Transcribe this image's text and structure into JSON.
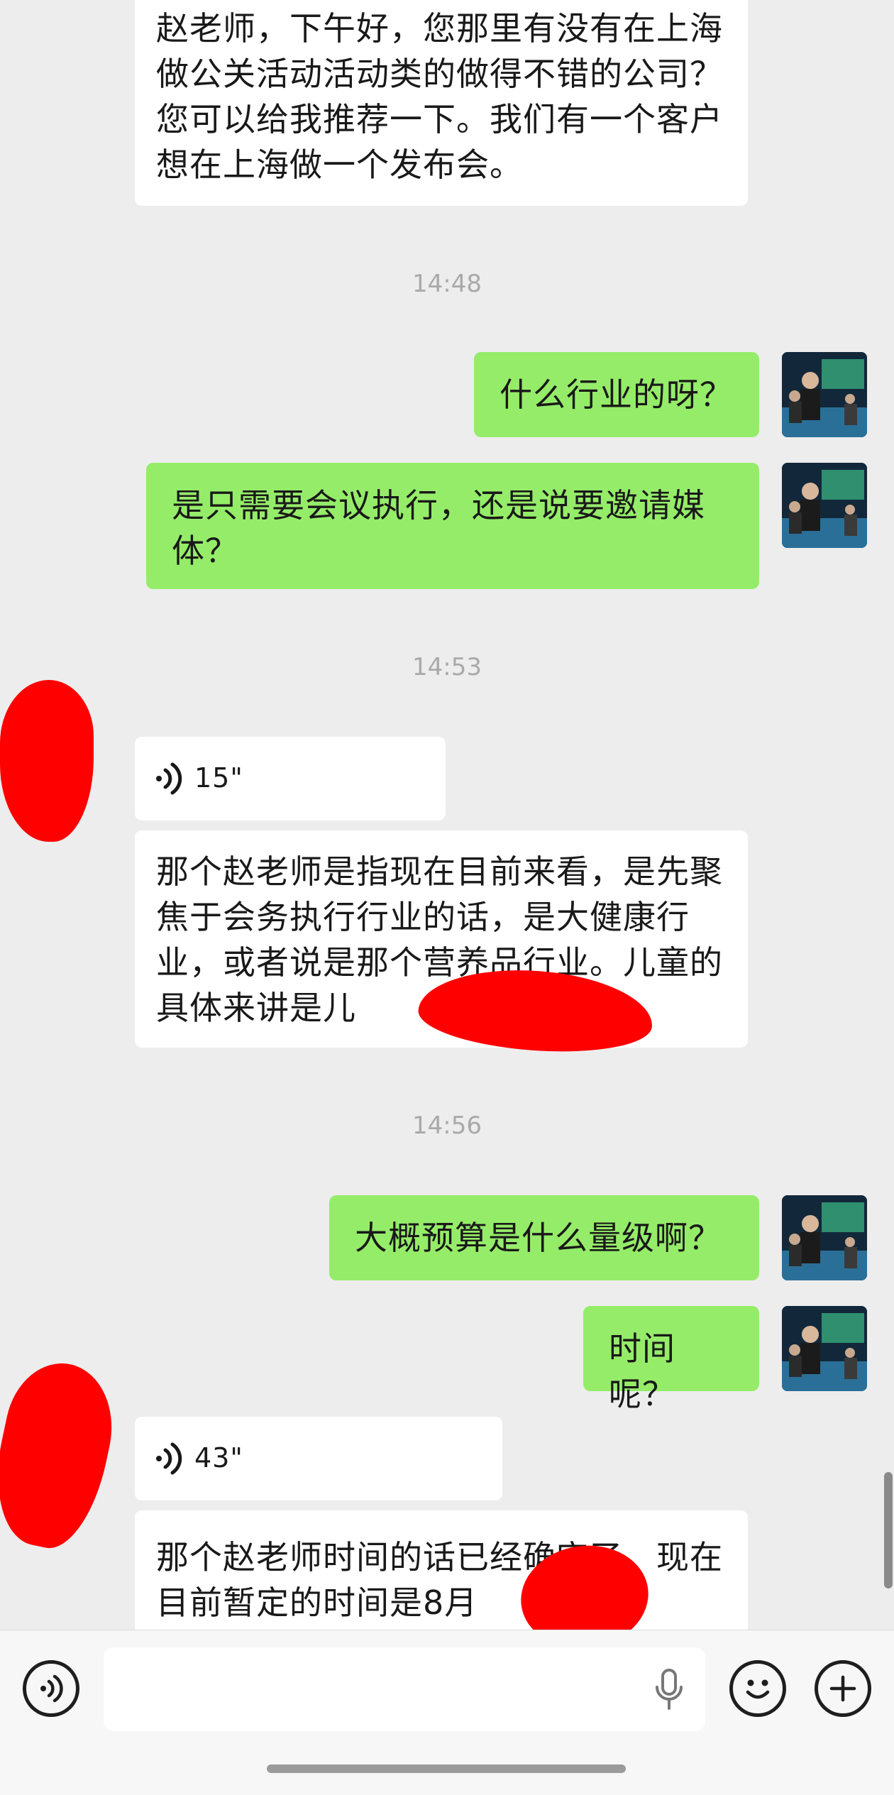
{
  "messages": {
    "m1": "赵老师，下午好，您那里有没有在上海做公关活动活动类的做得不错的公司？您可以给我推荐一下。我们有一个客户想在上海做一个发布会。",
    "t1": "14:48",
    "m2": "什么行业的呀？",
    "m3": "是只需要会议执行，还是说要邀请媒体？",
    "t2": "14:53",
    "voice1": "15\"",
    "m4": "那个赵老师是指现在目前来看，是先聚焦于会务执行行业的话，是大健康行业，或者说是那个营养品行业。儿童的具体来讲是儿",
    "t3": "14:56",
    "m5": "大概预算是什么量级啊？",
    "m6": "时间呢？",
    "voice2": "43\"",
    "m7": "那个赵老师时间的话已经确定了，现在目前暂定的时间是8月"
  },
  "icons": {
    "voice_toggle": "voice-mode-icon",
    "mic": "microphone-icon",
    "emoji": "emoji-icon",
    "plus": "plus-icon"
  },
  "colors": {
    "background": "#ededed",
    "incoming_bubble": "#ffffff",
    "outgoing_bubble": "#95ec69",
    "timestamp": "#a9a9a9",
    "redaction": "#ff0000"
  }
}
